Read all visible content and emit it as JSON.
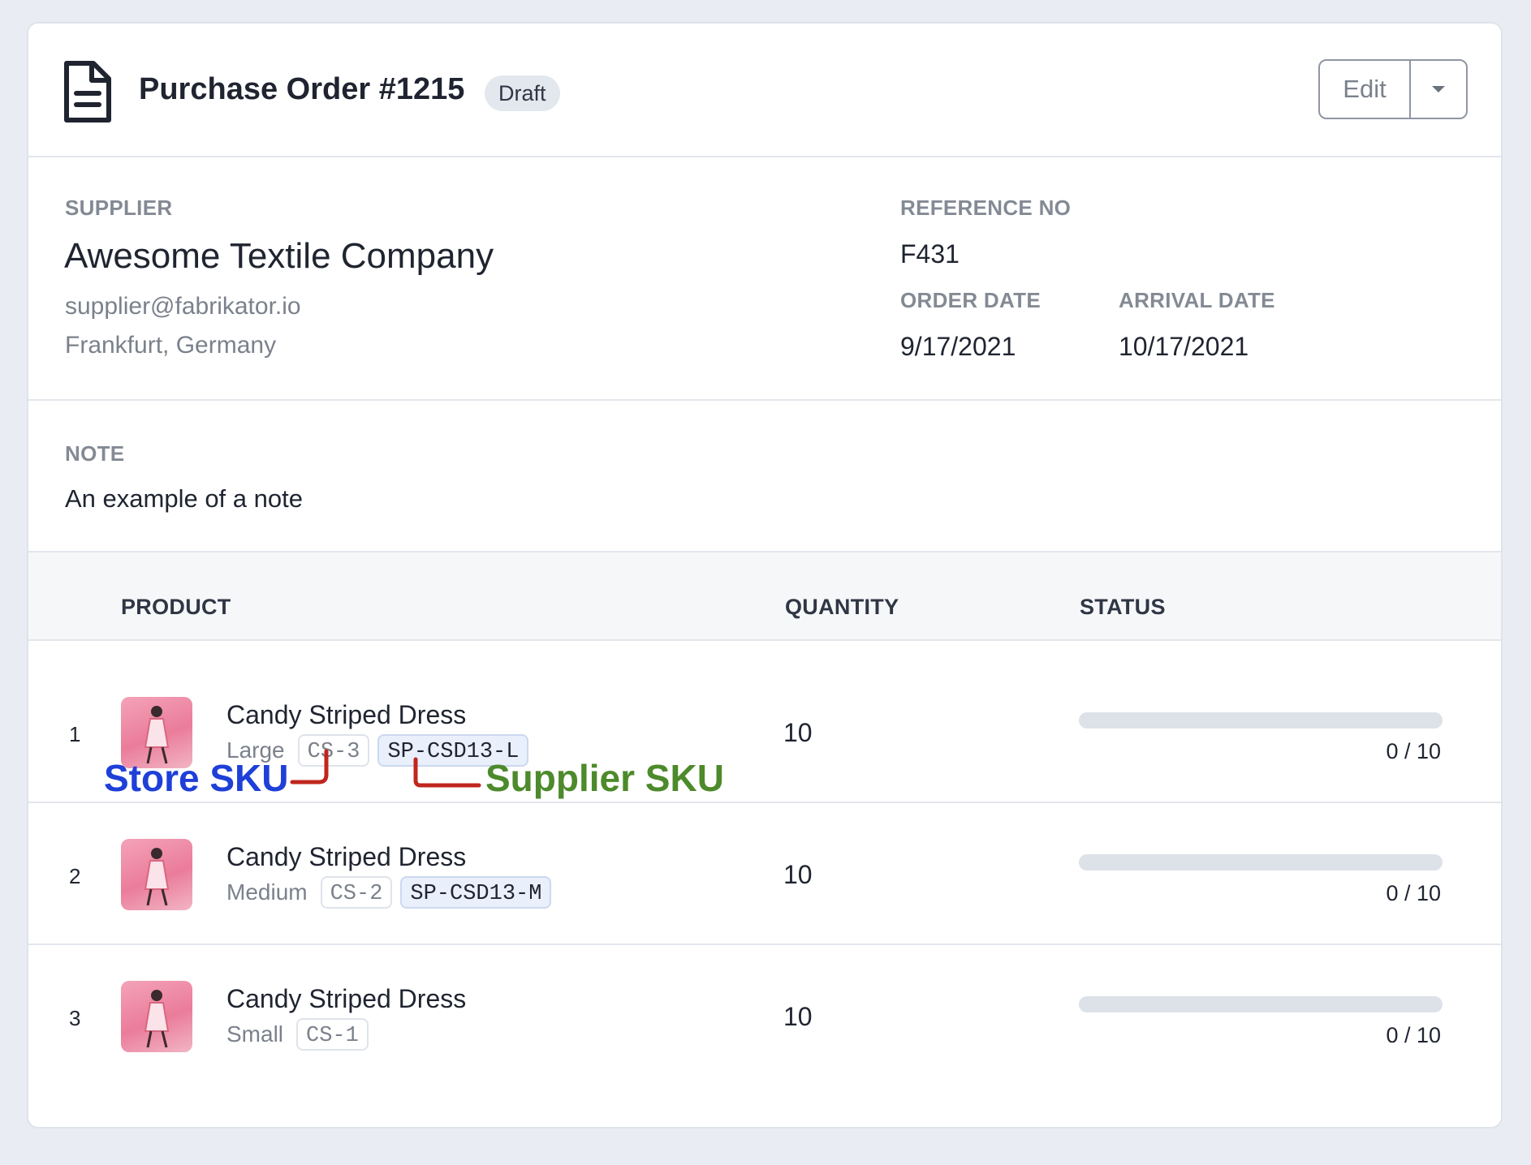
{
  "header": {
    "title": "Purchase Order #1215",
    "status_badge": "Draft",
    "edit_label": "Edit"
  },
  "supplier": {
    "label": "SUPPLIER",
    "name": "Awesome Textile Company",
    "email": "supplier@fabrikator.io",
    "location": "Frankfurt, Germany"
  },
  "reference": {
    "label": "REFERENCE NO",
    "value": "F431"
  },
  "order_date": {
    "label": "ORDER DATE",
    "value": "9/17/2021"
  },
  "arrival_date": {
    "label": "ARRIVAL DATE",
    "value": "10/17/2021"
  },
  "note": {
    "label": "NOTE",
    "text": "An example of a note"
  },
  "table": {
    "headers": {
      "product": "PRODUCT",
      "quantity": "QUANTITY",
      "status": "STATUS"
    },
    "rows": [
      {
        "index": "1",
        "name": "Candy Striped Dress",
        "variant": "Large",
        "store_sku": "CS-3",
        "supplier_sku": "SP-CSD13-L",
        "quantity": "10",
        "received_ratio": "0 / 10",
        "progress": 0
      },
      {
        "index": "2",
        "name": "Candy Striped Dress",
        "variant": "Medium",
        "store_sku": "CS-2",
        "supplier_sku": "SP-CSD13-M",
        "quantity": "10",
        "received_ratio": "0 / 10",
        "progress": 0
      },
      {
        "index": "3",
        "name": "Candy Striped Dress",
        "variant": "Small",
        "store_sku": "CS-1",
        "supplier_sku": "",
        "quantity": "10",
        "received_ratio": "0 / 10",
        "progress": 0
      }
    ]
  },
  "annotations": {
    "store_sku": "Store SKU",
    "supplier_sku": "Supplier SKU"
  },
  "icons": {
    "document": "document-icon",
    "dropdown": "chevron-down-icon",
    "thumbnail": "product-thumbnail"
  },
  "colors": {
    "annotation_store": "#1e3fd8",
    "annotation_supplier": "#4d8a2b",
    "annotation_arrow": "#c0261e",
    "badge_bg": "#e3e7ee",
    "progress_track": "#dde1e8"
  }
}
